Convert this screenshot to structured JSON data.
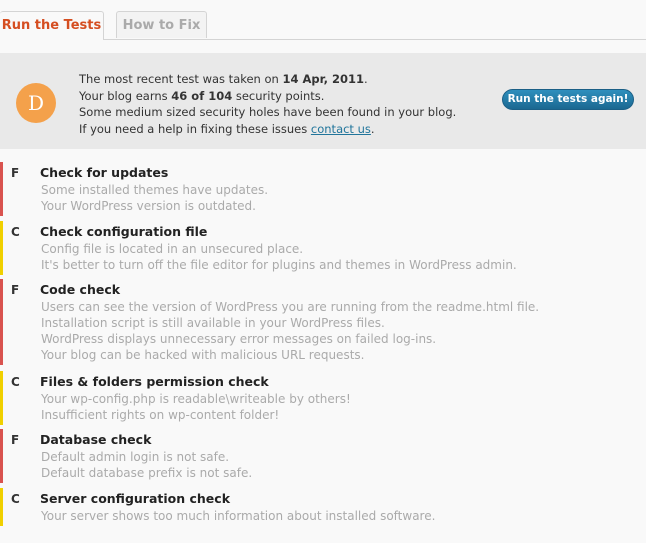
{
  "tabs": [
    {
      "label": "Run the Tests",
      "active": true
    },
    {
      "label": "How to Fix",
      "active": false
    }
  ],
  "summary": {
    "grade": "D",
    "grade_color": "#f4a14b",
    "line1_prefix": "The most recent test was taken on ",
    "date": "14 Apr, 2011",
    "line1_suffix": ".",
    "line2_prefix": "Your blog earns ",
    "score": "46 of 104",
    "line2_suffix": " security points.",
    "line3": "Some medium sized security holes have been found in your blog.",
    "line4_prefix": "If you need a help in fixing these issues ",
    "contact_link": "contact us",
    "line4_suffix": ".",
    "run_button": "Run the tests again!"
  },
  "colors": {
    "fail": "#d9534f",
    "warn": "#f0d000"
  },
  "checks": [
    {
      "grade": "F",
      "status": "fail",
      "title": "Check for updates",
      "lines": [
        "Some installed themes have updates.",
        "Your WordPress version is outdated."
      ]
    },
    {
      "grade": "C",
      "status": "warn",
      "title": "Check configuration file",
      "lines": [
        "Config file is located in an unsecured place.",
        "It's better to turn off the file editor for plugins and themes in WordPress admin."
      ]
    },
    {
      "grade": "F",
      "status": "fail",
      "title": "Code check",
      "lines": [
        "Users can see the version of WordPress you are running from the readme.html file.",
        "Installation script is still available in your WordPress files.",
        "WordPress displays unnecessary error messages on failed log-ins.",
        "Your blog can be hacked with malicious URL requests."
      ]
    },
    {
      "grade": "C",
      "status": "warn",
      "title": "Files & folders permission check",
      "lines": [
        "Your wp-config.php is readable\\writeable by others!",
        "Insufficient rights on wp-content folder!"
      ]
    },
    {
      "grade": "F",
      "status": "fail",
      "title": "Database check",
      "lines": [
        "Default admin login is not safe.",
        "Default database prefix is not safe."
      ]
    },
    {
      "grade": "C",
      "status": "warn",
      "title": "Server configuration check",
      "lines": [
        "Your server shows too much information about installed software."
      ]
    }
  ]
}
